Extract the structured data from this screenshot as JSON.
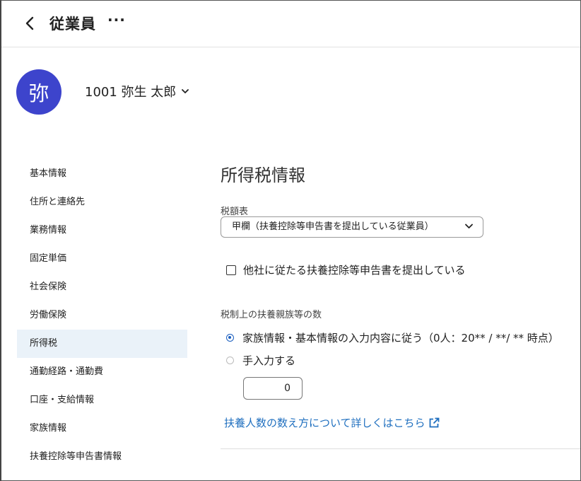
{
  "header": {
    "title": "従業員",
    "more_label": "···"
  },
  "employee": {
    "avatar_text": "弥",
    "name": "1001 弥生 太郎"
  },
  "sidebar": {
    "items": [
      {
        "label": "基本情報",
        "active": false
      },
      {
        "label": "住所と連絡先",
        "active": false
      },
      {
        "label": "業務情報",
        "active": false
      },
      {
        "label": "固定単価",
        "active": false
      },
      {
        "label": "社会保険",
        "active": false
      },
      {
        "label": "労働保険",
        "active": false
      },
      {
        "label": "所得税",
        "active": true
      },
      {
        "label": "通勤経路・通勤費",
        "active": false
      },
      {
        "label": "口座・支給情報",
        "active": false
      },
      {
        "label": "家族情報",
        "active": false
      },
      {
        "label": "扶養控除等申告書情報",
        "active": false
      }
    ]
  },
  "main": {
    "section_title": "所得税情報",
    "tax_table": {
      "label": "税額表",
      "value": "甲欄（扶養控除等申告書を提出している従業員）"
    },
    "other_company_checkbox": {
      "label": "他社に従たる扶養控除等申告書を提出している",
      "checked": false
    },
    "dependents": {
      "label": "税制上の扶養親族等の数",
      "option_family": "家族情報・基本情報の入力内容に従う（0人：20** / **/ ** 時点）",
      "option_manual": "手入力する",
      "selected": "family",
      "manual_value": "0"
    },
    "help_link": "扶養人数の数え方について詳しくはこちら"
  },
  "colors": {
    "avatar_bg": "#3d44cc",
    "link": "#1f6fbf",
    "active_bg": "#eaf2f9",
    "radio_accent": "#1b5fbf"
  }
}
